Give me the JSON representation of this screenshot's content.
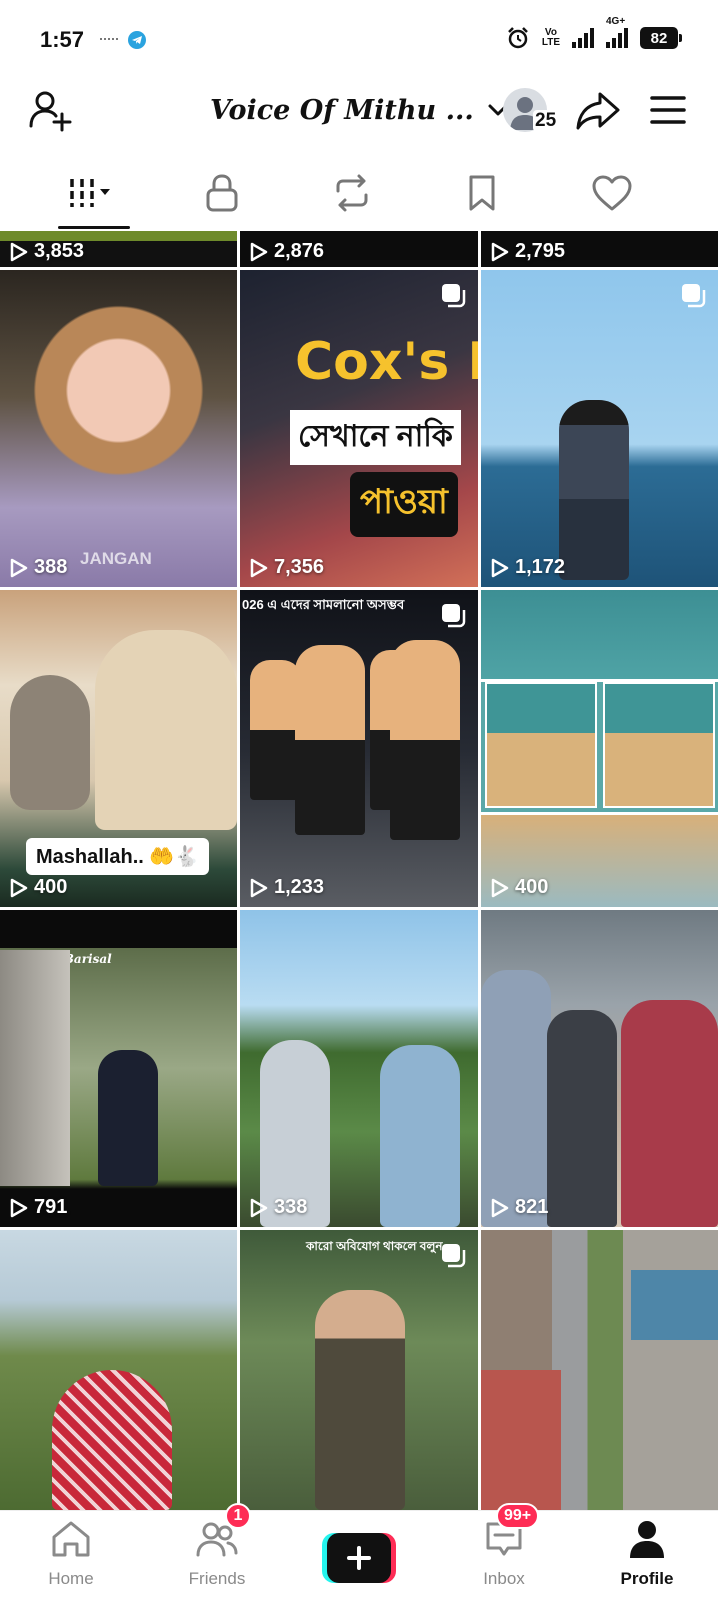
{
  "status_bar": {
    "time": "1:57",
    "volte_top": "Vo",
    "volte_bottom": "LTE",
    "network": "4G+",
    "battery": "82"
  },
  "header": {
    "title": "Voice Of Mithu ...",
    "profile_views": "25"
  },
  "tabs": [
    {
      "icon": "videos-grid-icon",
      "active": true
    },
    {
      "icon": "lock-icon"
    },
    {
      "icon": "repost-icon"
    },
    {
      "icon": "bookmark-icon"
    },
    {
      "icon": "heart-icon"
    }
  ],
  "videos": [
    {
      "views": "3,853"
    },
    {
      "views": "2,876"
    },
    {
      "views": "2,795"
    },
    {
      "views": "388",
      "caption": "JANGAN"
    },
    {
      "views": "7,356",
      "caption_main": "Cox's B",
      "caption_bn1": "সেখানে নাকি",
      "caption_bn2": "পাওয়া"
    },
    {
      "views": "1,172"
    },
    {
      "views": "400",
      "caption": "Mashallah.. 🤲🐇"
    },
    {
      "views": "1,233",
      "caption": "026 এ এদের সামলানো অসম্ভব"
    },
    {
      "views": "400"
    },
    {
      "views": "791",
      "caption": "Made In Barisal"
    },
    {
      "views": "338"
    },
    {
      "views": "821"
    },
    {
      "views": ""
    },
    {
      "views": "",
      "caption": "কারো অবিযোগ থাকলে বলুন"
    },
    {
      "views": ""
    }
  ],
  "bottom_nav": {
    "home": "Home",
    "friends": "Friends",
    "friends_badge": "1",
    "inbox": "Inbox",
    "inbox_badge": "99+",
    "profile": "Profile"
  },
  "colors": {
    "accent_red": "#fe2c55",
    "accent_cyan": "#25f4ee"
  }
}
